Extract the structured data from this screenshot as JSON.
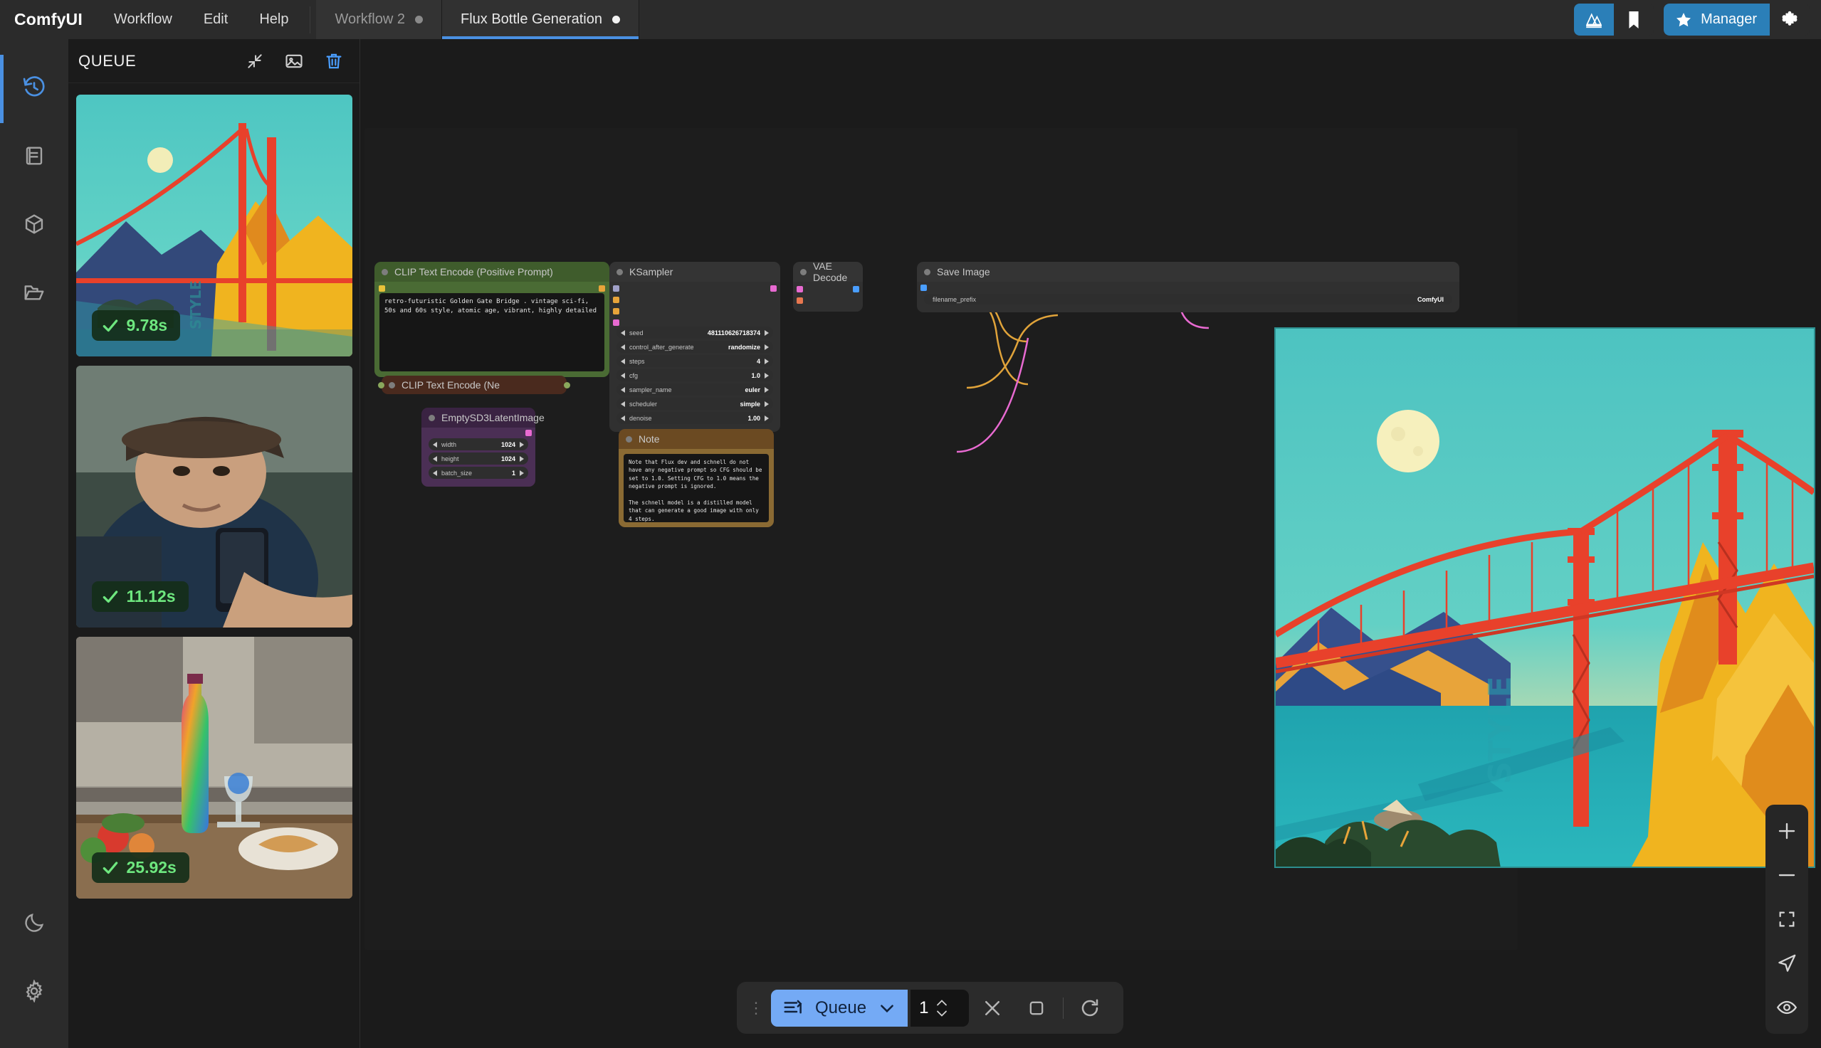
{
  "app": {
    "brand": "ComfyUI",
    "menus": [
      "Workflow",
      "Edit",
      "Help"
    ]
  },
  "tabs": [
    {
      "label": "Workflow 2",
      "active": false,
      "modified": true
    },
    {
      "label": "Flux Bottle Generation",
      "active": true,
      "modified": true
    }
  ],
  "topright": {
    "logo_icon": "comfy-logo-icon",
    "bookmark_icon": "bookmark-icon",
    "manager_label": "Manager",
    "manager_icon": "star-icon",
    "extension_icon": "puzzle-piece-icon"
  },
  "rail": {
    "items": [
      {
        "name": "queue-history",
        "icon": "history-clock-icon",
        "active": true
      },
      {
        "name": "node-library",
        "icon": "book-icon",
        "active": false
      },
      {
        "name": "model-library",
        "icon": "cube-icon",
        "active": false
      },
      {
        "name": "workflows-browser",
        "icon": "folder-icon",
        "active": false
      }
    ],
    "bottom": [
      {
        "name": "theme-toggle",
        "icon": "moon-icon"
      },
      {
        "name": "settings",
        "icon": "gear-icon"
      }
    ]
  },
  "queue": {
    "title": "QUEUE",
    "actions": [
      {
        "name": "collapse-panel",
        "icon": "collapse-arrows-icon"
      },
      {
        "name": "gallery-view",
        "icon": "image-icon"
      },
      {
        "name": "clear-queue",
        "icon": "trash-icon",
        "color": "#4a9eff"
      }
    ],
    "items": [
      {
        "duration": "9.78s",
        "status": "success",
        "subject": "golden-gate-bridge-retro-poster"
      },
      {
        "duration": "11.12s",
        "status": "success",
        "subject": "man-in-car-with-phone"
      },
      {
        "duration": "25.92s",
        "status": "success",
        "subject": "rainbow-bottle-kitchen-still-life"
      }
    ]
  },
  "graph": {
    "nodes": [
      {
        "id": "clip-positive",
        "title": "CLIP Text Encode (Positive Prompt)",
        "header_color": "#3f5c2c",
        "body_color": "#4a6b34",
        "text": "retro-futuristic Golden Gate Bridge . vintage sci-fi, 50s and 60s style, atomic age, vibrant, highly detailed"
      },
      {
        "id": "clip-negative",
        "title": "CLIP Text Encode (Ne",
        "header_color": "#4a2a1e",
        "body_color": "#4a2a1e"
      },
      {
        "id": "empty-latent",
        "title": "EmptySD3LatentImage",
        "header_color": "#3a2342",
        "body_color": "#4b2f55",
        "widgets": [
          {
            "name": "width",
            "value": "1024"
          },
          {
            "name": "height",
            "value": "1024"
          },
          {
            "name": "batch_size",
            "value": "1"
          }
        ]
      },
      {
        "id": "ksampler",
        "title": "KSampler",
        "header_color": "#343434",
        "body_color": "#303030",
        "widgets": [
          {
            "name": "seed",
            "value": "481110626718374"
          },
          {
            "name": "control_after_generate",
            "value": "randomize"
          },
          {
            "name": "steps",
            "value": "4"
          },
          {
            "name": "cfg",
            "value": "1.0"
          },
          {
            "name": "sampler_name",
            "value": "euler"
          },
          {
            "name": "scheduler",
            "value": "simple"
          },
          {
            "name": "denoise",
            "value": "1.00"
          }
        ]
      },
      {
        "id": "vae-decode",
        "title": "VAE Decode",
        "header_color": "#343434",
        "body_color": "#303030"
      },
      {
        "id": "save-image",
        "title": "Save Image",
        "header_color": "#343434",
        "body_color": "#303030",
        "widgets": [
          {
            "name": "filename_prefix",
            "value": "ComfyUI"
          }
        ]
      },
      {
        "id": "note",
        "title": "Note",
        "header_color": "#6b4a22",
        "body_color": "#8a6a33",
        "text": "Note that Flux dev and schnell do not have any negative prompt so CFG should be set to 1.0. Setting CFG to 1.0 means the negative prompt is ignored.\n\nThe schnell model is a distilled model that can generate a good image with only 4 steps."
      }
    ]
  },
  "bottombar": {
    "grip_icon": "drag-handle-icon",
    "queue_label": "Queue",
    "queue_icon": "queue-list-icon",
    "chevron_icon": "chevron-down-icon",
    "count": "1",
    "spin_up_icon": "chevron-up-icon",
    "spin_down_icon": "chevron-down-icon",
    "cancel_icon": "close-x-icon",
    "stop_icon": "stop-square-icon",
    "refresh_icon": "refresh-icon"
  },
  "rightbar": {
    "buttons": [
      {
        "name": "zoom-in",
        "icon": "plus-icon"
      },
      {
        "name": "zoom-out",
        "icon": "minus-icon"
      },
      {
        "name": "fit-view",
        "icon": "fit-frame-icon"
      },
      {
        "name": "select-tool",
        "icon": "cursor-arrow-icon"
      },
      {
        "name": "toggle-visibility",
        "icon": "eye-icon"
      }
    ]
  }
}
